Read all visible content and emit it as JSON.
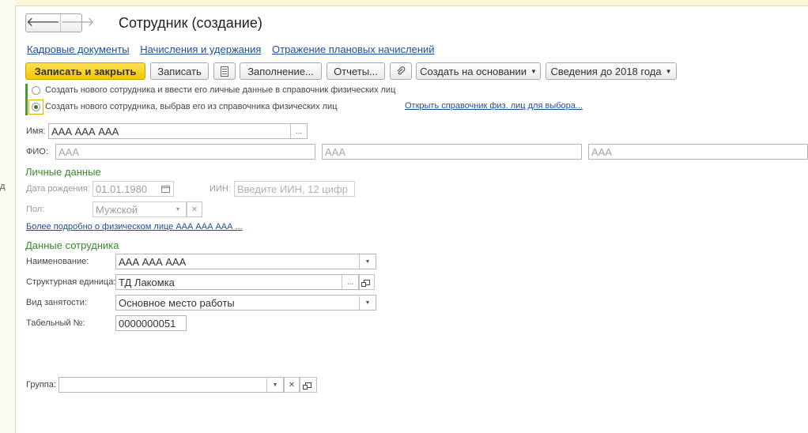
{
  "window": {
    "title": "Сотрудник (создание)"
  },
  "nav": {
    "back_glyph": "🡐",
    "forward_glyph": "🡒"
  },
  "links": [
    "Кадровые документы",
    "Начисления и удержания",
    "Отражение плановых начислений"
  ],
  "toolbar": {
    "save_close": "Записать и закрыть",
    "save": "Записать",
    "fill": "Заполнение...",
    "reports": "Отчеты...",
    "create_based_on": "Создать на основании",
    "info_before_2018": "Сведения до 2018 года"
  },
  "radio": {
    "option1": "Создать нового сотрудника и ввести его личные данные в справочник физических лиц",
    "option2": "Создать нового сотрудника, выбрав его из справочника физических лиц",
    "selected": 2,
    "open_link": "Открыть справочник физ. лиц для выбора..."
  },
  "form": {
    "name_label": "Имя:",
    "name_value": "ААА ААА ААА",
    "fio_label": "ФИО:",
    "fio_last": "ААА",
    "fio_first": "ААА",
    "fio_middle": "ААА"
  },
  "personal": {
    "section_title": "Личные данные",
    "dob_label": "Дата рождения:",
    "dob_value": "01.01.1980",
    "iin_label": "ИИН:",
    "iin_placeholder": "Введите ИИН, 12 цифр",
    "gender_label": "Пол:",
    "gender_value": "Мужской",
    "more_link": "Более подробно о физическом лице ААА ААА ААА ..."
  },
  "employee": {
    "section_title": "Данные сотрудника",
    "name_label": "Наименование:",
    "name_value": "ААА ААА ААА",
    "unit_label": "Структурная единица:",
    "unit_value": "ТД Лакомка",
    "employment_label": "Вид занятости:",
    "employment_value": "Основное место работы",
    "tabnum_label": "Табельный №:",
    "tabnum_value": "0000000051"
  },
  "group": {
    "label": "Группа:",
    "value": ""
  },
  "gutter": {
    "char": "д"
  },
  "colors": {
    "accent_green": "#3a8a2e",
    "primary_button": "#f5c700",
    "link": "#1f4d9c"
  }
}
